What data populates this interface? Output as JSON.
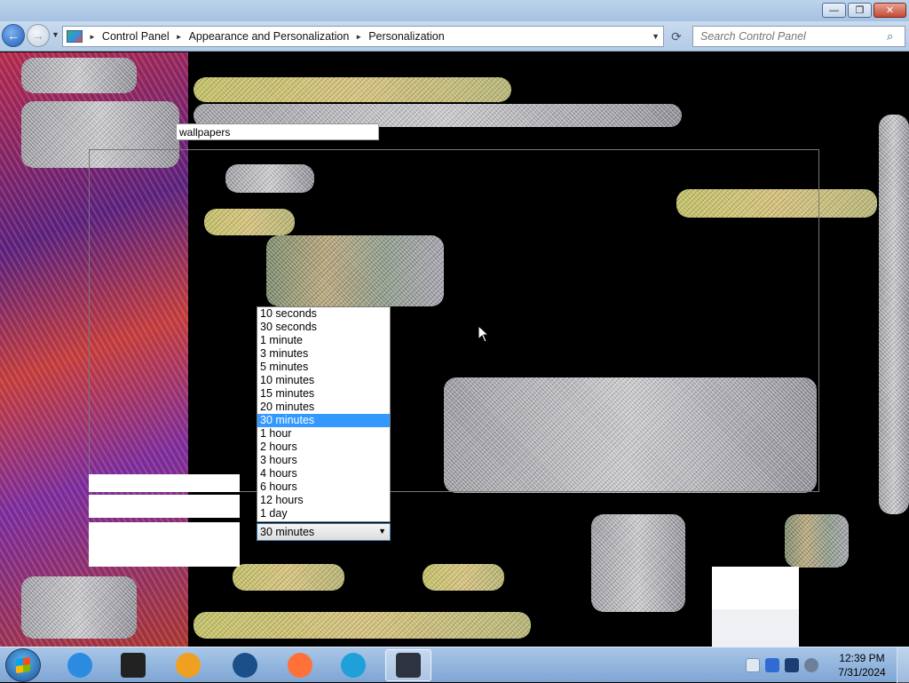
{
  "window": {
    "minimize_glyph": "—",
    "maximize_glyph": "❐",
    "close_glyph": "✕"
  },
  "nav": {
    "back_glyph": "←",
    "forward_glyph": "→",
    "history_glyph": "▼",
    "refresh_glyph": "⟳",
    "breadcrumbs": [
      "Control Panel",
      "Appearance and Personalization",
      "Personalization"
    ],
    "separator": "►",
    "address_dropdown_glyph": "▼",
    "search_placeholder": "Search Control Panel",
    "search_glyph": "⌕"
  },
  "content": {
    "wallpaper_field_value": "wallpapers",
    "interval_options": [
      "10 seconds",
      "30 seconds",
      "1 minute",
      "3 minutes",
      "5 minutes",
      "10 minutes",
      "15 minutes",
      "20 minutes",
      "30 minutes",
      "1 hour",
      "2 hours",
      "3 hours",
      "4 hours",
      "6 hours",
      "12 hours",
      "1 day"
    ],
    "selected_interval": "30 minutes",
    "dropdown_arrow": "▼"
  },
  "taskbar": {
    "apps": [
      {
        "name": "internet-explorer",
        "color": "#2b8be0"
      },
      {
        "name": "terminal",
        "color": "#222222"
      },
      {
        "name": "media-player",
        "color": "#f0a020"
      },
      {
        "name": "globe",
        "color": "#1a4f8a"
      },
      {
        "name": "firefox",
        "color": "#ff7139"
      },
      {
        "name": "edge",
        "color": "#1fa0d8"
      },
      {
        "name": "control-panel",
        "color": "#2d3440"
      }
    ],
    "clock_time": "12:39 PM",
    "clock_date": "7/31/2024"
  },
  "colors": {
    "selection": "#3399ff",
    "titlebar": "#bcd3ec",
    "taskbar": "#8fb3dc"
  }
}
